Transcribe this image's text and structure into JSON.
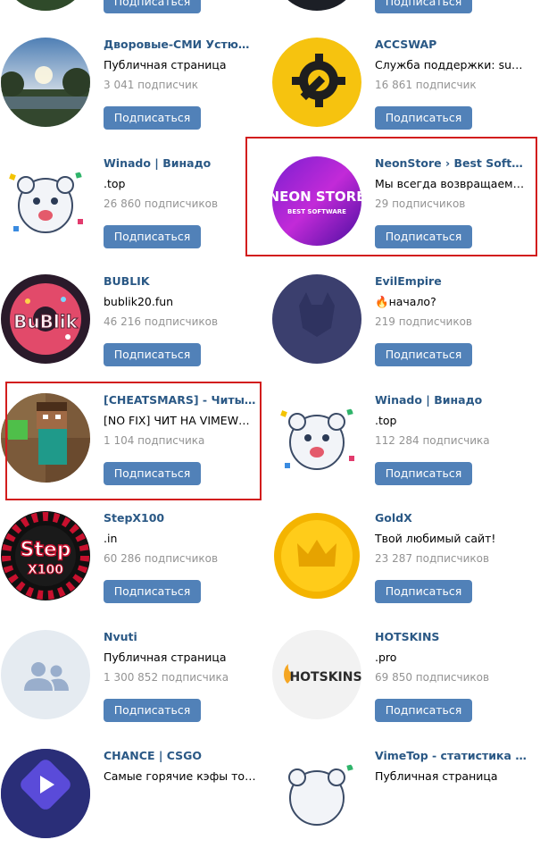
{
  "colors": {
    "link": "#2a5885",
    "button": "#5181b8",
    "count": "#939393",
    "highlight": "#d21d1d"
  },
  "communities": [
    {
      "name": "",
      "desc": "",
      "count": "",
      "button": "Подписаться",
      "avatar": "landscape-photo"
    },
    {
      "name": "",
      "desc": "",
      "count": "",
      "button": "Подписаться",
      "avatar": "dark-logo"
    },
    {
      "name": "Дворовые-СМИ Устюжны",
      "desc": "Публичная страница",
      "count": "3 041 подписчик",
      "button": "Подписаться",
      "avatar": "park-photo"
    },
    {
      "name": "ACCSWAP",
      "desc": "Служба поддержки: suppor...",
      "count": "16 861 подписчик",
      "button": "Подписаться",
      "avatar": "wrench-gear-logo"
    },
    {
      "name": "Winado | Винадо",
      "desc": ".top",
      "count": "26 860 подписчиков",
      "button": "Подписаться",
      "avatar": "cartoon-bear"
    },
    {
      "name": "NeonStore › Best Software",
      "desc": "Мы всегда возвращаемся ...",
      "count": "29 подписчиков",
      "button": "Подписаться",
      "avatar": "neon-store-logo",
      "logo_title": "NEON STORE",
      "logo_sub": "BEST SOFTWARE"
    },
    {
      "name": "BUBLIK",
      "desc": "bublik20.fun",
      "count": "46 216 подписчиков",
      "button": "Подписаться",
      "avatar": "bublik-donut-logo",
      "logo_title": "BuBlik"
    },
    {
      "name": "EvilEmpire",
      "desc": "🔥начало?",
      "count": "219 подписчиков",
      "button": "Подписаться",
      "avatar": "evil-mask-logo"
    },
    {
      "name": "[CHEATSMARS] - Читы на ...",
      "desc": "[NO FIX] ЧИТ НА VIMEWORL...",
      "count": "1 104 подписчика",
      "button": "Подписаться",
      "avatar": "minecraft-steve"
    },
    {
      "name": "Winado | Винадо",
      "desc": ".top",
      "count": "112 284 подписчика",
      "button": "Подписаться",
      "avatar": "cartoon-bear"
    },
    {
      "name": "StepX100",
      "desc": ".in",
      "count": "60 286 подписчиков",
      "button": "Подписаться",
      "avatar": "roulette-logo",
      "logo_title": "Step",
      "logo_sub": "X100"
    },
    {
      "name": "GoldX",
      "desc": "Твой любимый сайт!",
      "count": "23 287 подписчиков",
      "button": "Подписаться",
      "avatar": "gold-crown-coin"
    },
    {
      "name": "Nvuti",
      "desc": "Публичная страница",
      "count": "1 300 852 подписчика",
      "button": "Подписаться",
      "avatar": "default-group-icon"
    },
    {
      "name": "HOTSKINS",
      "desc": ".pro",
      "count": "69 850 подписчиков",
      "button": "Подписаться",
      "avatar": "hotskins-logo",
      "logo_title": "HOTSKINS"
    },
    {
      "name": "CHANCE | CSGO",
      "desc": "Самые горячие кэфы толь...",
      "count": "",
      "button": "",
      "avatar": "chance-logo"
    },
    {
      "name": "VimeTop - статистика игро...",
      "desc": "Публичная страница",
      "count": "",
      "button": "",
      "avatar": "cartoon-bear"
    }
  ]
}
